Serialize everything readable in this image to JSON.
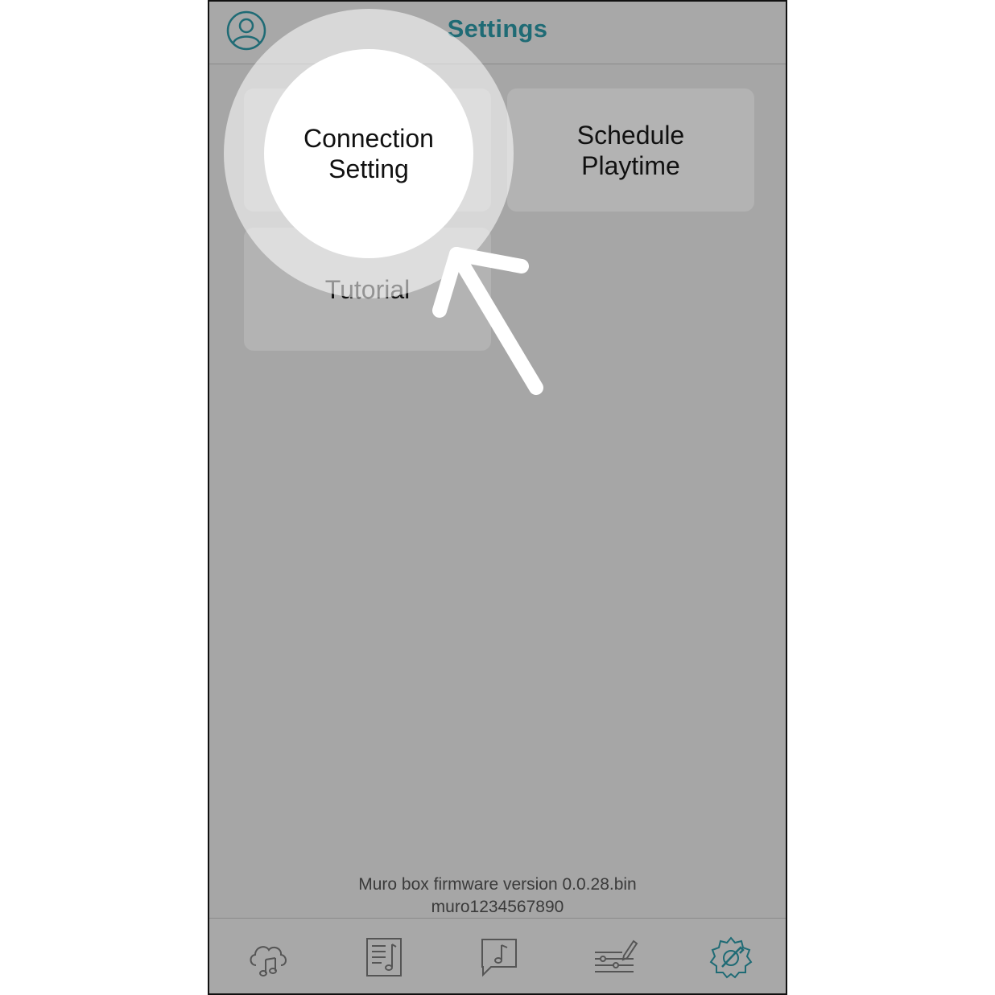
{
  "header": {
    "title": "Settings"
  },
  "tiles": {
    "connection": "Connection\nSetting",
    "schedule": "Schedule\nPlaytime",
    "tutorial": "Tutorial"
  },
  "footer": {
    "firmware": "Muro box firmware version 0.0.28.bin",
    "device_id": "muro1234567890"
  },
  "tabbar": {
    "icons": [
      "cloud-music-icon",
      "music-sheet-icon",
      "music-chat-icon",
      "equalizer-edit-icon",
      "settings-gear-icon"
    ],
    "active": "settings-gear-icon"
  },
  "colors": {
    "accent": "#1f6b75",
    "background": "#a6a6a6",
    "tile": "#b3b3b3"
  }
}
